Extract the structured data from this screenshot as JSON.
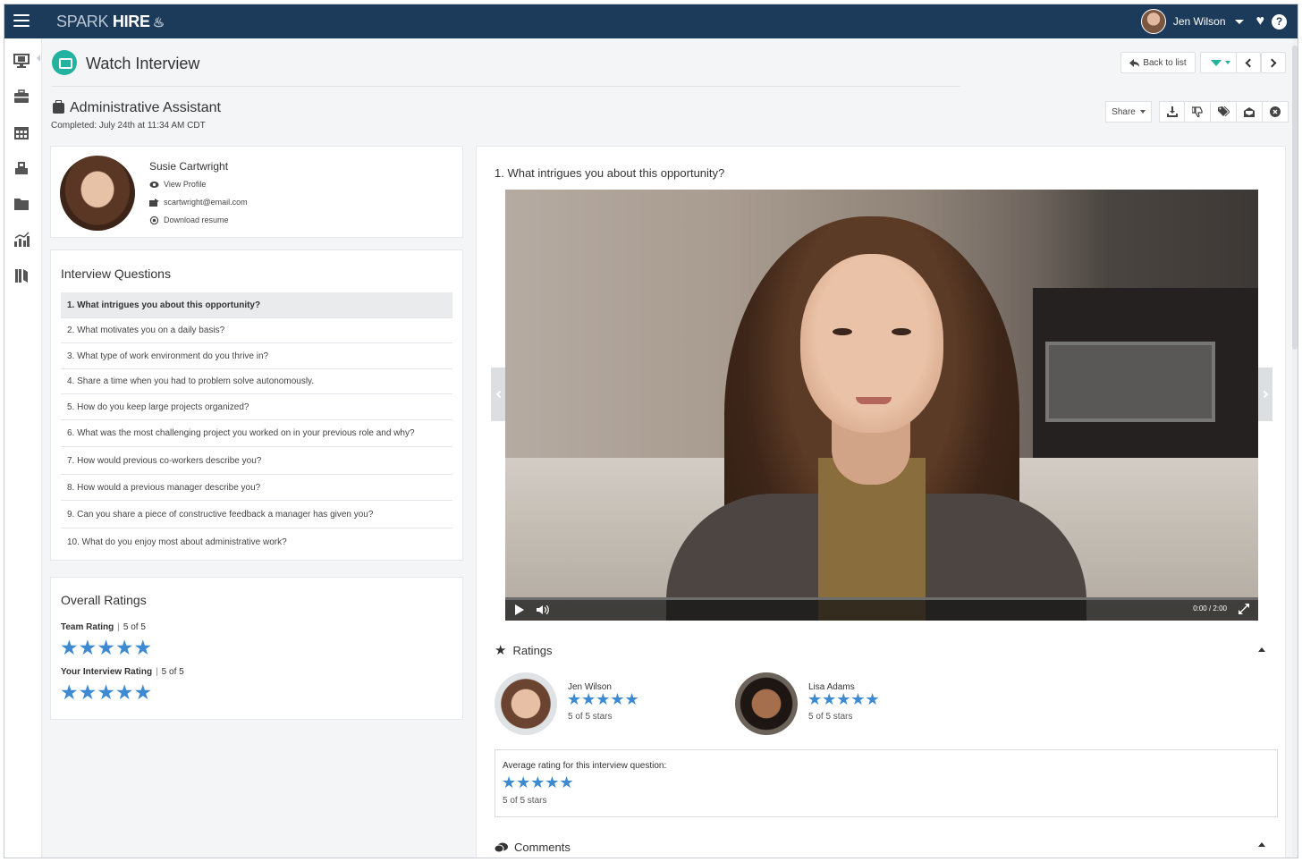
{
  "app": {
    "logo": "HIRE",
    "logo_prefix": "SPARK",
    "user_name": "Jen Wilson"
  },
  "header": {
    "title": "Watch Interview",
    "back_label": "Back to list"
  },
  "job": {
    "title": "Administrative Assistant",
    "completed": "Completed: July 24th at 11:34 AM CDT",
    "share_label": "Share"
  },
  "candidate": {
    "name": "Susie Cartwright",
    "view_profile": "View Profile",
    "email": "scartwright@email.com",
    "download_resume": "Download resume"
  },
  "questions": {
    "title": "Interview Questions",
    "items": [
      "1. What intrigues you about this opportunity?",
      "2. What motivates you on a daily basis?",
      "3. What type of work environment do you thrive in?",
      "4. Share a time when you had to problem solve autonomously.",
      "5. How do you keep large projects organized?",
      "6. What was the most challenging project you worked on in your previous role and why?",
      "7. How would previous co-workers describe you?",
      "8. How would a previous manager describe you?",
      "9. Can you share a piece of constructive feedback a manager has given you?",
      "10. What do you enjoy most about administrative work?"
    ],
    "active_index": 0
  },
  "overall_ratings": {
    "title": "Overall Ratings",
    "team_label": "Team Rating",
    "team_value": "5 of 5",
    "team_stars": 5,
    "your_label": "Your Interview Rating",
    "your_value": "5 of 5",
    "your_stars": 5
  },
  "video": {
    "question": "1. What intrigues you about this opportunity?",
    "time": "0:00 / 2:00"
  },
  "ratings": {
    "title": "Ratings",
    "raters": [
      {
        "name": "Jen Wilson",
        "stars": 5,
        "text": "5 of 5 stars"
      },
      {
        "name": "Lisa Adams",
        "stars": 5,
        "text": "5 of 5 stars"
      }
    ],
    "avg_label": "Average rating for this interview question:",
    "avg_stars": 5,
    "avg_text": "5 of 5 stars"
  },
  "comments": {
    "title": "Comments"
  },
  "colors": {
    "topbar": "#1c3a5a",
    "accent": "#21b3a0",
    "star": "#3d8ad2"
  },
  "star_glyphs": "★★★★★"
}
